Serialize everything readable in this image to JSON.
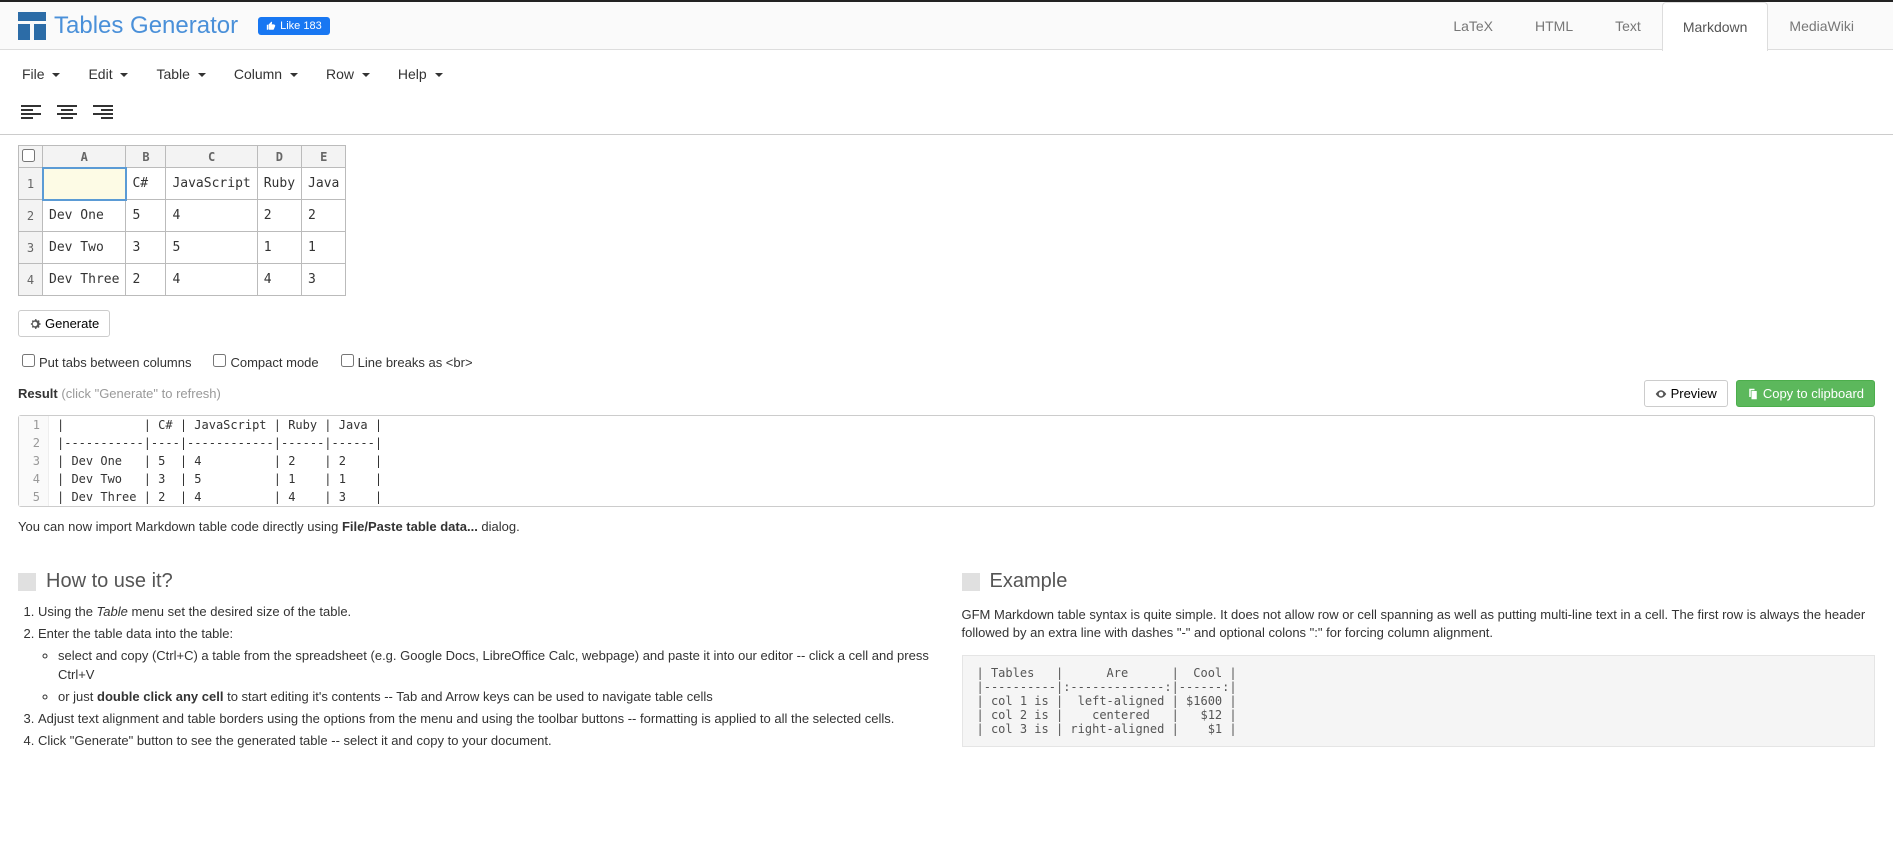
{
  "brand": "Tables Generator",
  "fb_like": "Like 183",
  "format_tabs": [
    "LaTeX",
    "HTML",
    "Text",
    "Markdown",
    "MediaWiki"
  ],
  "active_format_tab": 3,
  "menus": [
    "File",
    "Edit",
    "Table",
    "Column",
    "Row",
    "Help"
  ],
  "col_headers": [
    "A",
    "B",
    "C",
    "D",
    "E"
  ],
  "grid": [
    [
      "",
      "C#",
      "JavaScript",
      "Ruby",
      "Java"
    ],
    [
      "Dev One",
      "5",
      "4",
      "2",
      "2"
    ],
    [
      "Dev Two",
      "3",
      "5",
      "1",
      "1"
    ],
    [
      "Dev Three",
      "2",
      "4",
      "4",
      "3"
    ]
  ],
  "selected_cell": [
    0,
    0
  ],
  "generate_btn": "Generate",
  "options": {
    "tabs": "Put tabs between columns",
    "compact": "Compact mode",
    "br": "Line breaks as <br>"
  },
  "result_label": "Result",
  "result_hint": "(click \"Generate\" to refresh)",
  "preview_btn": "Preview",
  "copy_btn": "Copy to clipboard",
  "code_lines": [
    "|           | C# | JavaScript | Ruby | Java |",
    "|-----------|----|------------|------|------|",
    "| Dev One   | 5  | 4          | 2    | 2    |",
    "| Dev Two   | 3  | 5          | 1    | 1    |",
    "| Dev Three | 2  | 4          | 4    | 3    |"
  ],
  "import_note_pre": "You can now import Markdown table code directly using ",
  "import_note_bold": "File/Paste table data...",
  "import_note_post": " dialog.",
  "howto_title": "How to use it?",
  "howto": {
    "li1_a": "Using the ",
    "li1_em": "Table",
    "li1_b": " menu set the desired size of the table.",
    "li2": "Enter the table data into the table:",
    "li2a": "select and copy (Ctrl+C) a table from the spreadsheet (e.g. Google Docs, LibreOffice Calc, webpage) and paste it into our editor -- click a cell and press Ctrl+V",
    "li2b_a": "or just ",
    "li2b_bold": "double click any cell",
    "li2b_b": " to start editing it's contents -- Tab and Arrow keys can be used to navigate table cells",
    "li3": "Adjust text alignment and table borders using the options from the menu and using the toolbar buttons -- formatting is applied to all the selected cells.",
    "li4": "Click \"Generate\" button to see the generated table -- select it and copy to your document."
  },
  "example_title": "Example",
  "example_desc": "GFM Markdown table syntax is quite simple. It does not allow row or cell spanning as well as putting multi-line text in a cell. The first row is always the header followed by an extra line with dashes \"-\" and optional colons \":\" for forcing column alignment.",
  "example_code": "| Tables   |      Are      |  Cool |\n|----------|:-------------:|------:|\n| col 1 is |  left-aligned | $1600 |\n| col 2 is |    centered   |   $12 |\n| col 3 is | right-aligned |    $1 |"
}
